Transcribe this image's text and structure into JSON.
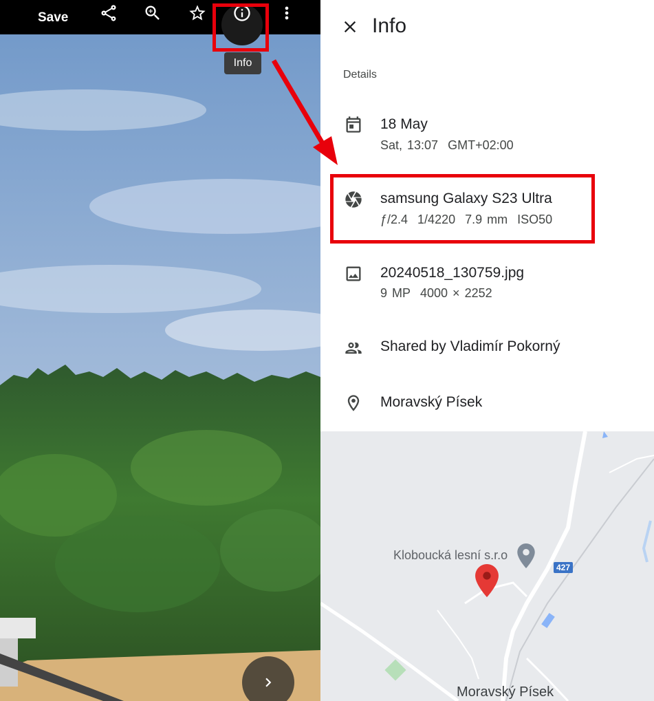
{
  "toolbar": {
    "save_label": "Save",
    "tooltip": "Info",
    "icons": [
      "share-icon",
      "zoom-in-icon",
      "star-icon",
      "info-icon",
      "more-vert-icon"
    ]
  },
  "panel": {
    "title": "Info",
    "section": "Details",
    "date": {
      "main": "18 May",
      "day_time": "Sat, 13:07",
      "timezone": "GMT+02:00"
    },
    "camera": {
      "model": "samsung Galaxy S23 Ultra",
      "aperture": "ƒ/2.4",
      "shutter": "1/4220",
      "focal": "7.9 mm",
      "iso": "ISO50"
    },
    "file": {
      "name": "20240518_130759.jpg",
      "megapixels": "9 MP",
      "resolution": "4000 × 2252"
    },
    "shared": "Shared by Vladimír Pokorný",
    "location": "Moravský Písek"
  },
  "map": {
    "poi": "Kloboucká lesní s.r.o",
    "town": "Moravský Písek",
    "road": "427"
  },
  "colors": {
    "highlight": "#e8000b",
    "pin": "#e53935",
    "road_badge": "#3a73c6"
  }
}
